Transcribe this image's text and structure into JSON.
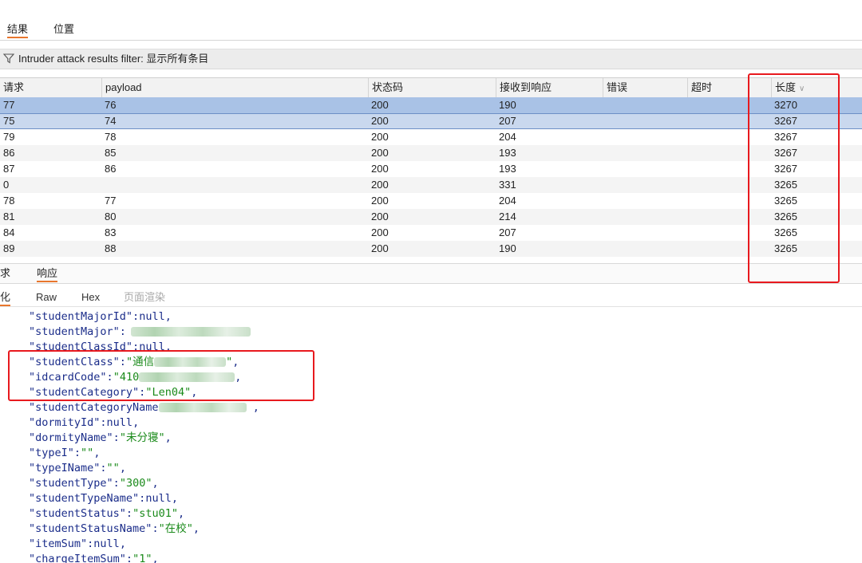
{
  "top_tabs": [
    "结果",
    "位置"
  ],
  "filter": {
    "text": "Intruder attack results filter: 显示所有条目"
  },
  "table": {
    "columns": [
      "请求",
      "payload",
      "状态码",
      "接收到响应",
      "错误",
      "超时",
      "长度"
    ],
    "rows": [
      [
        "77",
        "76",
        "200",
        "190",
        "",
        "",
        "3270"
      ],
      [
        "75",
        "74",
        "200",
        "207",
        "",
        "",
        "3267"
      ],
      [
        "79",
        "78",
        "200",
        "204",
        "",
        "",
        "3267"
      ],
      [
        "86",
        "85",
        "200",
        "193",
        "",
        "",
        "3267"
      ],
      [
        "87",
        "86",
        "200",
        "193",
        "",
        "",
        "3267"
      ],
      [
        "0",
        "",
        "200",
        "331",
        "",
        "",
        "3265"
      ],
      [
        "78",
        "77",
        "200",
        "204",
        "",
        "",
        "3265"
      ],
      [
        "81",
        "80",
        "200",
        "214",
        "",
        "",
        "3265"
      ],
      [
        "84",
        "83",
        "200",
        "207",
        "",
        "",
        "3265"
      ],
      [
        "89",
        "88",
        "200",
        "190",
        "",
        "",
        "3265"
      ]
    ]
  },
  "mid_tabs": [
    "求",
    "响应"
  ],
  "sub_tabs": [
    "化",
    "Raw",
    "Hex",
    "页面渲染"
  ],
  "code": {
    "l1_key": "\"studentMajorId\"",
    "l1_val": "null",
    "l2_key": "\"studentMajor\"",
    "l3_key": "\"studentClassId\"",
    "l3_val": "null",
    "l4_key": "\"studentClass\"",
    "l4_val": "\"通信",
    "l5_key": "\"idcardCode\"",
    "l5_val": "\"410",
    "l6_key": "\"studentCategory\"",
    "l6_val": "\"Len04\"",
    "l7_key": "\"studentCategoryName",
    "l8_key": "\"dormityId\"",
    "l8_val": "null",
    "l9_key": "\"dormityName\"",
    "l9_val": "\"未分寝\"",
    "l10_key": "\"typeI\"",
    "l10_val": "\"\"",
    "l11_key": "\"typeIName\"",
    "l11_val": "\"\"",
    "l12_key": "\"studentType\"",
    "l12_val": "\"300\"",
    "l13_key": "\"studentTypeName\"",
    "l13_val": "null",
    "l14_key": "\"studentStatus\"",
    "l14_val": "\"stu01\"",
    "l15_key": "\"studentStatusName\"",
    "l15_val": "\"在校\"",
    "l16_key": "\"itemSum\"",
    "l16_val": "null",
    "l17_key": "\"chargeItemSum\"",
    "l17_val": "\"1\""
  },
  "colors": {
    "selected_row": "#a9c2e6",
    "annotation": "#e8191e",
    "tab_accent": "#e8762d"
  }
}
